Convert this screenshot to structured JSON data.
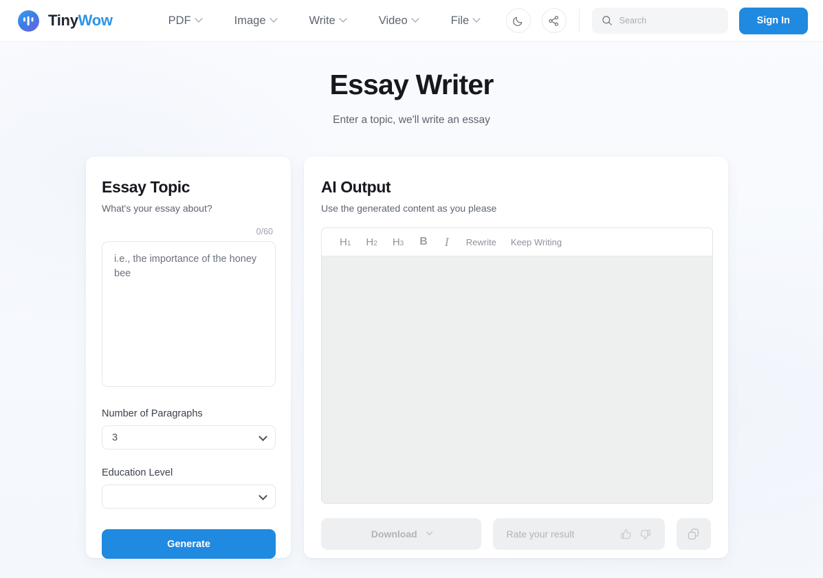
{
  "header": {
    "brand": {
      "first": "Tiny",
      "second": "Wow",
      "logo_icon": "tinywow-logo-icon"
    },
    "nav": [
      {
        "label": "PDF"
      },
      {
        "label": "Image"
      },
      {
        "label": "Write"
      },
      {
        "label": "Video"
      },
      {
        "label": "File"
      }
    ],
    "dark_mode_icon": "moon-icon",
    "share_icon": "share-icon",
    "search": {
      "placeholder": "Search",
      "value": "",
      "icon": "search-icon"
    },
    "signin_label": "Sign In"
  },
  "page": {
    "title": "Essay Writer",
    "subtitle": "Enter a topic, we'll write an essay"
  },
  "left_panel": {
    "title": "Essay Topic",
    "subtitle": "What's your essay about?",
    "counter": "0/60",
    "topic": {
      "value": "",
      "placeholder": "i.e., the importance of the honey bee"
    },
    "paragraphs": {
      "label": "Number of Paragraphs",
      "value": "3"
    },
    "education": {
      "label": "Education Level",
      "value": ""
    },
    "generate_label": "Generate"
  },
  "right_panel": {
    "title": "AI Output",
    "subtitle": "Use the generated content as you please",
    "toolbar": {
      "h1": "H",
      "h1_sub": "1",
      "h2": "H",
      "h2_sub": "2",
      "h3": "H",
      "h3_sub": "3",
      "bold": "B",
      "italic": "I",
      "rewrite": "Rewrite",
      "keep_writing": "Keep Writing"
    },
    "output_text": "",
    "download_label": "Download",
    "rate_label": "Rate your result",
    "thumbs_up_icon": "thumbs-up-icon",
    "thumbs_down_icon": "thumbs-down-icon",
    "copy_icon": "copy-icon"
  },
  "colors": {
    "accent": "#2089e0",
    "brand_accent": "#2c94e8",
    "page_bg": "#f7f9fc",
    "editor_body": "#eeefef"
  }
}
